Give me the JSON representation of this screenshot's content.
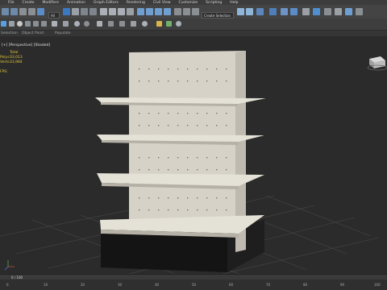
{
  "menu": [
    "File",
    "Create",
    "Modifiers",
    "Animation",
    "Graph Editors",
    "Rendering",
    "Civil View",
    "Customize",
    "Scripting",
    "Help"
  ],
  "toolbar": {
    "selection_filter": "All",
    "named_selection": "Create Selection Se"
  },
  "ribbon": {
    "tabs": [
      "Selection",
      "Object Paint",
      "Populate"
    ]
  },
  "viewport": {
    "label": "[+] [Perspective] [Shaded]",
    "stats": {
      "header": "Total",
      "polys_label": "Polys:",
      "polys_value": "33,013",
      "verts_label": "Verts:",
      "verts_value": "33,984",
      "fps_label": "FPS:"
    }
  },
  "timeline": {
    "frame": "0 / 100",
    "ticks": [
      "0",
      "10",
      "20",
      "30",
      "40",
      "50",
      "60",
      "70",
      "80",
      "90",
      "100"
    ]
  },
  "colors": {
    "background": "#2a2a2a",
    "toolbar": "#444444",
    "shelf": "#e4e1d6",
    "stats_text": "#e3c43a"
  }
}
